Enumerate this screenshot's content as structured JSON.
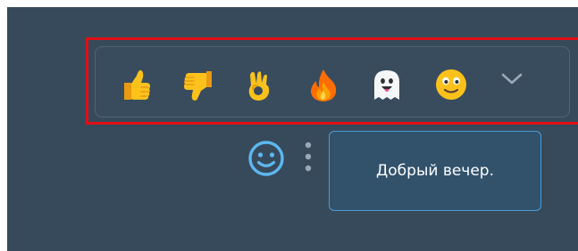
{
  "reactions": [
    {
      "name": "thumbs-up",
      "icon": "thumbs-up-icon"
    },
    {
      "name": "thumbs-down",
      "icon": "thumbs-down-icon"
    },
    {
      "name": "ok-hand",
      "icon": "ok-hand-icon"
    },
    {
      "name": "fire",
      "icon": "fire-icon"
    },
    {
      "name": "ghost",
      "icon": "ghost-icon"
    },
    {
      "name": "smiling-face",
      "icon": "smiling-face-icon"
    }
  ],
  "controls": {
    "more_reactions_icon": "chevron-down-icon",
    "emoji_picker_icon": "smiley-outline-icon",
    "message_menu_icon": "vertical-ellipsis-icon"
  },
  "message": {
    "text": "Добрый вечер."
  },
  "colors": {
    "background": "#374a5c",
    "highlight_border": "#e10f16",
    "bubble_fill": "#32526c",
    "bubble_border": "#4a9ad2",
    "accent_icon": "#5db7ef"
  }
}
